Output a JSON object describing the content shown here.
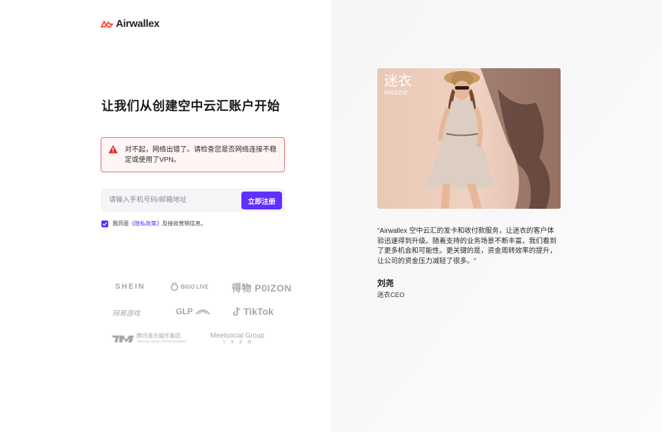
{
  "brand": {
    "logo_text": "Airwallex",
    "accent_color": "#612fff",
    "logo_color": "#ff4f42"
  },
  "page": {
    "title": "让我们从创建空中云汇账户开始"
  },
  "alert": {
    "icon": "warning-triangle-icon",
    "message": "对不起，网络出错了。请检查您是否网络连接不稳定或使用了VPN。",
    "color": "#e86a6a"
  },
  "signup": {
    "placeholder": "请输入手机号码/邮箱地址",
    "value": "",
    "button_label": "立即注册"
  },
  "consent": {
    "checked": true,
    "prefix": "我同意",
    "link_text": "《隐私政策》",
    "suffix": "及接收营销信息。"
  },
  "clients": {
    "shein": "SHEIN",
    "bigo": "BIGO LIVE",
    "poizon": "得物 P0IZON",
    "netease": "网易游戏",
    "glp": "GLP",
    "tiktok": "TikTok",
    "tme": "腾讯音乐娱乐集团",
    "tme_sub": "TENCENT MUSIC ENTERTAINMENT",
    "meetsocial": "Meetsocial Group",
    "meetsocial_sub": "飞 书 深 诺"
  },
  "testimonial": {
    "photo_brand_cn": "迷衣",
    "photo_brand_en": "mezzie",
    "quote": "\"Airwallex 空中云汇的发卡和收付款服务，让迷衣的客户体验迅速得到升级。随着支持的业务场景不断丰富，我们看到了更多机会和可能性。更关键的是，资金周转效率的提升，让公司的资金压力减轻了很多。\"",
    "author": "刘尧",
    "author_title": "迷衣CEO"
  }
}
